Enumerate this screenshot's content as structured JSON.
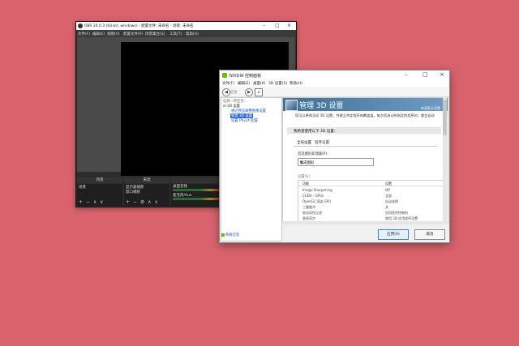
{
  "obs": {
    "title": "OBS 24.0.3 (64-bit, windows) - 配置文件: 未命名 - 场景: 未命名",
    "menu": [
      "文件(F)",
      "编辑(E)",
      "视图(V)",
      "配置文件(P)",
      "场景集合(S)",
      "工具(T)",
      "帮助(H)"
    ],
    "docks": {
      "scenes": {
        "title": "场景",
        "items": [
          "场景"
        ]
      },
      "sources": {
        "title": "来源",
        "items": [
          "显示器捕获",
          "窗口捕获"
        ]
      },
      "mixer": {
        "title": "混音器",
        "items": [
          "桌面音频",
          "麦克风/Aux"
        ]
      }
    },
    "status_text": "LIV"
  },
  "nvidia": {
    "title": "NVIDIA 控制面板",
    "menu": [
      "文件(F)",
      "编辑(E)",
      "桌面(K)",
      "3D 设置(S)",
      "帮助(H)"
    ],
    "toolbar": {
      "back_label": "后退"
    },
    "tasks_header": "选择一项任务...",
    "tasks": {
      "category": "3D 设置",
      "items": [
        "通过预览调整图像设置",
        "管理 3D 设置",
        "设置 PhysX 配置"
      ],
      "selected_index": 1
    },
    "page_title": "管理 3D 设置",
    "restore_link": "恢复默认设置",
    "description": "您可以更改全局 3D 设置，并建立特定程序的覆盖值。每次您启动所指定的程序时，都会自动",
    "section_header": "我希望使用以下 3D 设置：",
    "tabs": [
      "全局设置",
      "程序设置"
    ],
    "active_tab": 0,
    "processor_label": "首选图形处理器(P):",
    "processor_value": "集成图形",
    "settings_label": "设置(S):",
    "table": {
      "headers": [
        "功能",
        "设置"
      ],
      "rows": [
        [
          "Image Sharpening",
          "Off"
        ],
        [
          "CUDA - GPUs",
          "全部"
        ],
        [
          "OpenGL 渲染 GPU",
          "自动选择"
        ],
        [
          "三重缓冲",
          "关"
        ],
        [
          "各向异性过滤",
          "应用程序控制的"
        ],
        [
          "垂直同步",
          "使用 3D 应用程序设置"
        ]
      ]
    },
    "system_info_link": "系统信息",
    "buttons": {
      "apply": "应用(A)",
      "cancel": "取消"
    }
  }
}
